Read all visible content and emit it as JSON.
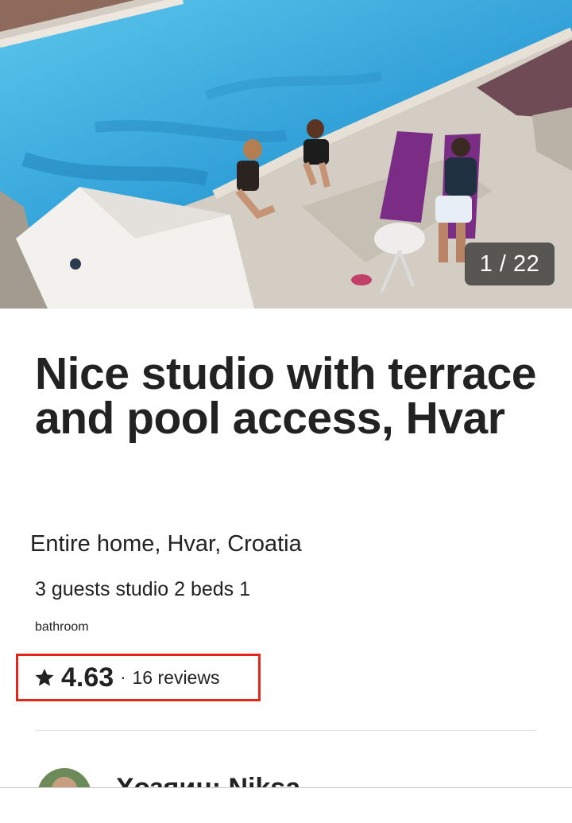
{
  "photo": {
    "counter": "1 / 22"
  },
  "listing": {
    "title": "Nice studio with terrace and pool access, Hvar",
    "subtitle": "Entire home, Hvar, Croatia",
    "details_line1": "3 guests studio 2 beds 1",
    "details_line2": "bathroom"
  },
  "rating": {
    "value": "4.63",
    "separator": "·",
    "reviews": "16 reviews",
    "icon": "star-icon"
  },
  "host": {
    "name": "Хозяин: Niksa"
  },
  "colors": {
    "highlight_border": "#e5261b",
    "text": "#222222"
  }
}
